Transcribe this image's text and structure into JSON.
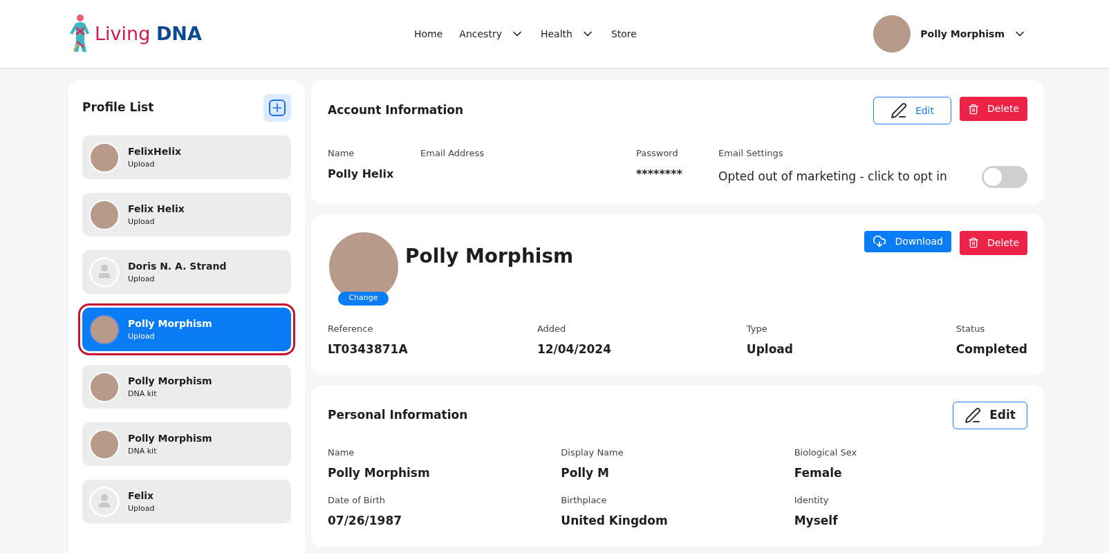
{
  "header": {
    "logo": {
      "light": "Living",
      "bold": "DNA"
    },
    "nav": [
      {
        "label": "Home",
        "dropdown": false
      },
      {
        "label": "Ancestry",
        "dropdown": true
      },
      {
        "label": "Health",
        "dropdown": true
      },
      {
        "label": "Store",
        "dropdown": false
      }
    ],
    "user": {
      "name": "Polly Morphism"
    }
  },
  "sidebar": {
    "title": "Profile List",
    "profiles": [
      {
        "name": "FelixHelix",
        "type": "Upload",
        "kind": "photo",
        "selected": false
      },
      {
        "name": "Felix Helix",
        "type": "Upload",
        "kind": "photo",
        "selected": false
      },
      {
        "name": "Doris N. A. Strand",
        "type": "Upload",
        "kind": "default",
        "selected": false
      },
      {
        "name": "Polly Morphism",
        "type": "Upload",
        "kind": "photo",
        "selected": true
      },
      {
        "name": "Polly Morphism",
        "type": "DNA kit",
        "kind": "photo",
        "selected": false
      },
      {
        "name": "Polly Morphism",
        "type": "DNA kit",
        "kind": "photo",
        "selected": false
      },
      {
        "name": "Felix",
        "type": "Upload",
        "kind": "default",
        "selected": false
      }
    ]
  },
  "account": {
    "title": "Account Information",
    "edit": "Edit",
    "delete": "Delete",
    "fields": [
      {
        "label": "Name",
        "value": "Polly Helix"
      },
      {
        "label": "Email Address"
      },
      {
        "label": "Password",
        "value": "********"
      }
    ],
    "email_settings": {
      "label": "Email Settings",
      "text": "Opted out of marketing - click to opt in",
      "on": false
    }
  },
  "profile": {
    "name": "Polly Morphism",
    "change": "Change",
    "download": "Download",
    "delete": "Delete",
    "fields": [
      {
        "label": "Reference",
        "value": "LT0343871A"
      },
      {
        "label": "Added",
        "value": "12/04/2024"
      },
      {
        "label": "Type",
        "value": "Upload"
      },
      {
        "label": "Status",
        "value": "Completed"
      }
    ]
  },
  "personal": {
    "title": "Personal Information",
    "edit": "Edit",
    "fields": [
      {
        "label": "Name",
        "value": "Polly Morphism"
      },
      {
        "label": "Display Name",
        "value": "Polly M"
      },
      {
        "label": "Biological Sex",
        "value": "Female"
      },
      {
        "label": "Date of Birth",
        "value": "07/26/1987"
      },
      {
        "label": "Birthplace",
        "value": "United Kingdom"
      },
      {
        "label": "Identity",
        "value": "Myself"
      }
    ]
  }
}
